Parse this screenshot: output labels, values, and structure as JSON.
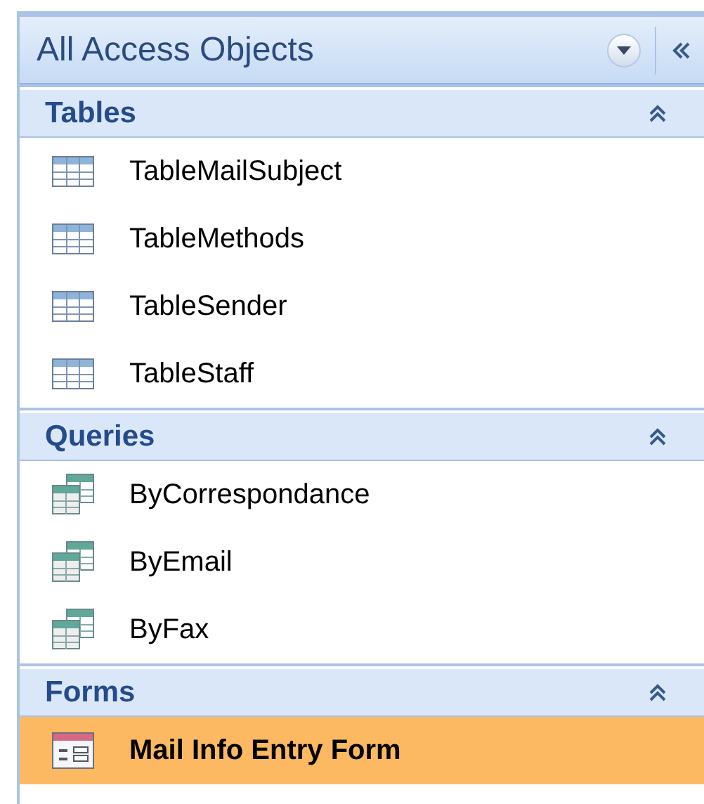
{
  "pane": {
    "title": "All Access Objects"
  },
  "groups": [
    {
      "label": "Tables",
      "expanded": true,
      "items": [
        {
          "kind": "table",
          "label": "TableMailSubject",
          "selected": false
        },
        {
          "kind": "table",
          "label": "TableMethods",
          "selected": false
        },
        {
          "kind": "table",
          "label": "TableSender",
          "selected": false
        },
        {
          "kind": "table",
          "label": "TableStaff",
          "selected": false
        }
      ]
    },
    {
      "label": "Queries",
      "expanded": true,
      "items": [
        {
          "kind": "query",
          "label": "ByCorrespondance",
          "selected": false
        },
        {
          "kind": "query",
          "label": "ByEmail",
          "selected": false
        },
        {
          "kind": "query",
          "label": "ByFax",
          "selected": false
        }
      ]
    },
    {
      "label": "Forms",
      "expanded": true,
      "items": [
        {
          "kind": "form",
          "label": "Mail Info Entry Form",
          "selected": true
        }
      ]
    }
  ]
}
